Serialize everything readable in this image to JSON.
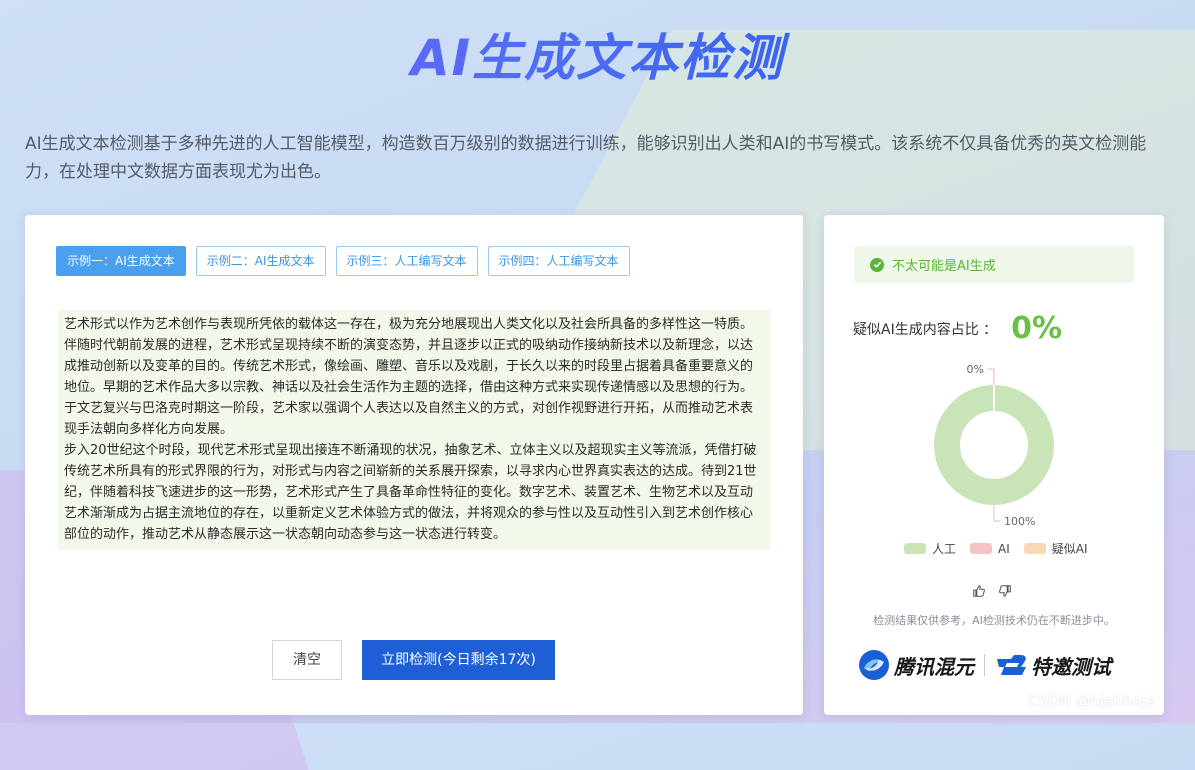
{
  "header": {
    "title": "AI生成文本检测",
    "intro": "AI生成文本检测基于多种先进的人工智能模型，构造数百万级别的数据进行训练，能够识别出人类和AI的书写模式。该系统不仅具备优秀的英文检测能力，在处理中文数据方面表现尤为出色。"
  },
  "tabs": [
    {
      "label": "示例一：AI生成文本",
      "active": true
    },
    {
      "label": "示例二：AI生成文本",
      "active": false
    },
    {
      "label": "示例三：人工编写文本",
      "active": false
    },
    {
      "label": "示例四：人工编写文本",
      "active": false
    }
  ],
  "input_text": {
    "paragraph1": "艺术形式以作为艺术创作与表现所凭依的载体这一存在，极为充分地展现出人类文化以及社会所具备的多样性这一特质。伴随时代朝前发展的进程，艺术形式呈现持续不断的演变态势，并且逐步以正式的吸纳动作接纳新技术以及新理念，以达成推动创新以及变革的目的。传统艺术形式，像绘画、雕塑、音乐以及戏剧，于长久以来的时段里占据着具备重要意义的地位。早期的艺术作品大多以宗教、神话以及社会生活作为主题的选择，借由这种方式来实现传递情感以及思想的行为。于文艺复兴与巴洛克时期这一阶段，艺术家以强调个人表达以及自然主义的方式，对创作视野进行开拓，从而推动艺术表现手法朝向多样化方向发展。",
    "paragraph2": "步入20世纪这个时段，现代艺术形式呈现出接连不断涌现的状况，抽象艺术、立体主义以及超现实主义等流派，凭借打破传统艺术所具有的形式界限的行为，对形式与内容之间崭新的关系展开探索，以寻求内心世界真实表达的达成。待到21世纪，伴随着科技飞速进步的这一形势，艺术形式产生了具备革命性特征的变化。数字艺术、装置艺术、生物艺术以及互动艺术渐渐成为占据主流地位的存在，以重新定义艺术体验方式的做法，并将观众的参与性以及互动性引入到艺术创作核心部位的动作，推动艺术从静态展示这一状态朝向动态参与这一状态进行转变。"
  },
  "buttons": {
    "clear": "清空",
    "detect": "立即检测(今日剩余17次)"
  },
  "result": {
    "verdict": "不太可能是AI生成",
    "ratio_label": "疑似AI生成内容占比 ：",
    "ratio_value": "0%",
    "disclaimer": "检测结果仅供参考，AI检测技术仍在不断进步中。"
  },
  "chart_data": {
    "type": "pie",
    "style": "donut",
    "categories": [
      "人工",
      "AI",
      "疑似AI"
    ],
    "values": [
      100,
      0,
      0
    ],
    "colors": [
      "#c9e5b8",
      "#f6c3c3",
      "#f6d9b5"
    ],
    "data_labels": {
      "top": "0%",
      "bottom": "100%"
    },
    "legend_position": "bottom"
  },
  "brands": {
    "hunyuan": "腾讯混元",
    "special": "特邀测试"
  },
  "watermark": "CSDN @hjehheje",
  "colors": {
    "primary": "#1f5fd6",
    "tab_active": "#4aa0ee",
    "success": "#5ab33a",
    "ratio": "#6bbf45"
  }
}
